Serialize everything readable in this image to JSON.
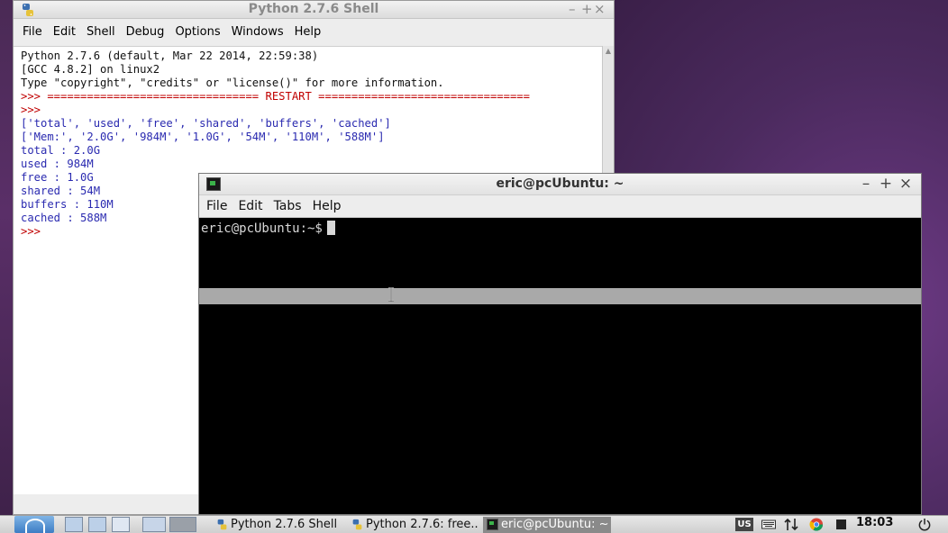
{
  "idle": {
    "title": "Python 2.7.6 Shell",
    "controls": [
      "–",
      "+",
      "×"
    ],
    "menu": [
      "File",
      "Edit",
      "Shell",
      "Debug",
      "Options",
      "Windows",
      "Help"
    ],
    "lines": [
      {
        "text": "Python 2.7.6 (default, Mar 22 2014, 22:59:38)",
        "color": "black"
      },
      {
        "text": "[GCC 4.8.2] on linux2",
        "color": "black"
      },
      {
        "text": "Type \"copyright\", \"credits\" or \"license()\" for more information.",
        "color": "black"
      },
      {
        "text": ">>> ================================ RESTART ================================",
        "color": "red"
      },
      {
        "text": ">>>",
        "color": "red"
      },
      {
        "text": "['total', 'used', 'free', 'shared', 'buffers', 'cached']",
        "color": "blue"
      },
      {
        "text": "['Mem:', '2.0G', '984M', '1.0G', '54M', '110M', '588M']",
        "color": "blue"
      },
      {
        "text": "total : 2.0G",
        "color": "blue"
      },
      {
        "text": "used : 984M",
        "color": "blue"
      },
      {
        "text": "free : 1.0G",
        "color": "blue"
      },
      {
        "text": "shared : 54M",
        "color": "blue"
      },
      {
        "text": "buffers : 110M",
        "color": "blue"
      },
      {
        "text": "cached : 588M",
        "color": "blue"
      },
      {
        "text": ">>>",
        "color": "red"
      }
    ]
  },
  "terminal": {
    "title": "eric@pcUbuntu: ~",
    "controls": [
      "–",
      "+",
      "×"
    ],
    "menu": [
      "File",
      "Edit",
      "Tabs",
      "Help"
    ],
    "prompt": "eric@pcUbuntu:~$"
  },
  "taskbar": {
    "tasks": [
      {
        "label": "Python 2.7.6 Shell",
        "active": false
      },
      {
        "label": "Python 2.7.6: free...",
        "active": false
      },
      {
        "label": "eric@pcUbuntu: ~",
        "active": true
      }
    ],
    "keyboard_layout": "US",
    "clock": "18:03"
  },
  "colors": {
    "idle_output": "#2a2ab0",
    "idle_prompt": "#c00000",
    "terminal_bg": "#000000",
    "desktop": "#5a2f68"
  }
}
